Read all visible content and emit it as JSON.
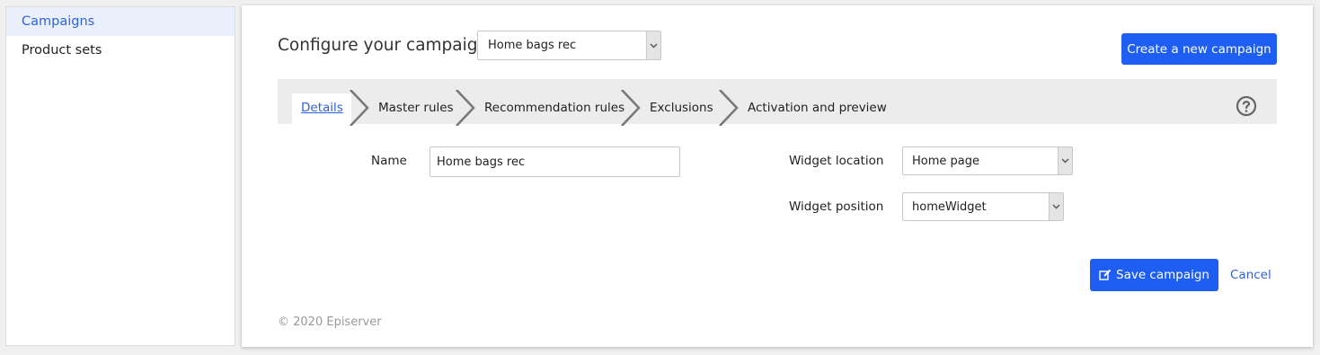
{
  "sidebar": {
    "items": [
      {
        "label": "Campaigns",
        "active": true
      },
      {
        "label": "Product sets",
        "active": false
      }
    ]
  },
  "header": {
    "title": "Configure your campaign",
    "campaign_select": {
      "value": "Home bags rec"
    },
    "create_button": "Create a new campaign"
  },
  "steps": [
    {
      "label": "Details",
      "active": true
    },
    {
      "label": "Master rules"
    },
    {
      "label": "Recommendation rules"
    },
    {
      "label": "Exclusions"
    },
    {
      "label": "Activation and preview"
    }
  ],
  "form": {
    "name_label": "Name",
    "name_value": "Home bags rec",
    "widget_location_label": "Widget location",
    "widget_location_value": "Home page",
    "widget_position_label": "Widget position",
    "widget_position_value": "homeWidget"
  },
  "actions": {
    "save_label": "Save campaign",
    "cancel_label": "Cancel"
  },
  "footer": {
    "copyright": "© 2020 Episerver"
  },
  "colors": {
    "accent": "#1e5ef3",
    "link": "#2e63d9",
    "step_bar": "#ececec"
  }
}
